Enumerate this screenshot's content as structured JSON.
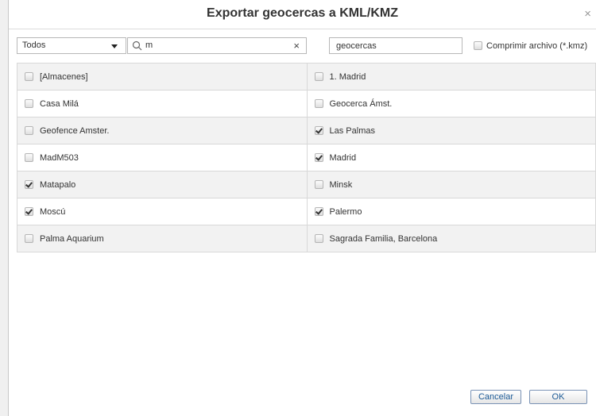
{
  "dialog": {
    "title": "Exportar geocercas a KML/KMZ",
    "close_symbol": "×"
  },
  "toolbar": {
    "filter_value": "Todos",
    "search_value": "m",
    "clear_symbol": "×",
    "filename_value": "geocercas",
    "compress_label": "Comprimir archivo (*.kmz)",
    "compress_checked": false
  },
  "rows": [
    [
      {
        "label": "[Almacenes]",
        "checked": false
      },
      {
        "label": "1. Madrid",
        "checked": false
      }
    ],
    [
      {
        "label": "Casa Milá",
        "checked": false
      },
      {
        "label": "Geocerca Ámst.",
        "checked": false
      }
    ],
    [
      {
        "label": "Geofence Amster.",
        "checked": false
      },
      {
        "label": "Las Palmas",
        "checked": true
      }
    ],
    [
      {
        "label": "MadM503",
        "checked": false
      },
      {
        "label": "Madrid",
        "checked": true
      }
    ],
    [
      {
        "label": "Matapalo",
        "checked": true
      },
      {
        "label": "Minsk",
        "checked": false
      }
    ],
    [
      {
        "label": "Moscú",
        "checked": true
      },
      {
        "label": "Palermo",
        "checked": true
      }
    ],
    [
      {
        "label": "Palma Aquarium",
        "checked": false
      },
      {
        "label": "Sagrada Familia, Barcelona",
        "checked": false
      }
    ]
  ],
  "footer": {
    "cancel_label": "Cancelar",
    "ok_label": "OK"
  }
}
